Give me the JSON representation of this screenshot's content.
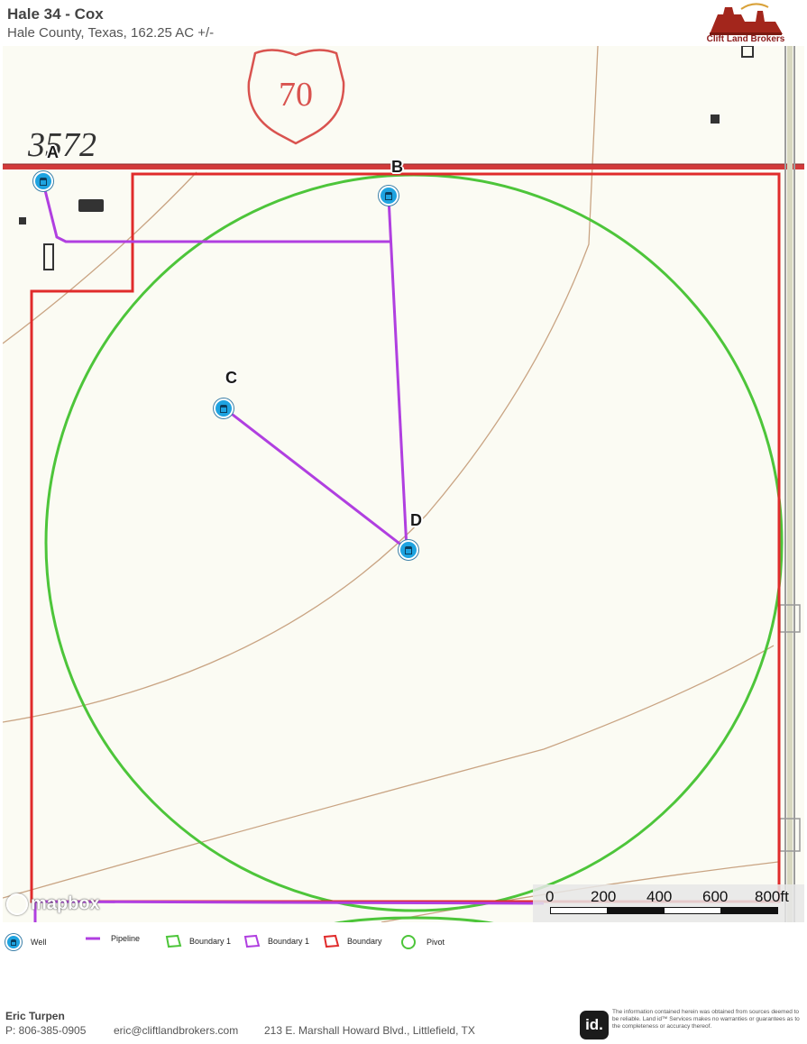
{
  "header": {
    "title": "Hale 34 - Cox",
    "subtitle": "Hale County, Texas, 162.25 AC +/-",
    "logo_text": "Clift Land Brokers"
  },
  "map": {
    "basemap_labels": {
      "route": "70",
      "road": "3572"
    },
    "wells": [
      {
        "label": "A"
      },
      {
        "label": "B"
      },
      {
        "label": "C"
      },
      {
        "label": "D"
      }
    ],
    "attribution": "mapbox",
    "scale": {
      "labels": [
        "0",
        "200",
        "400",
        "600",
        "800ft"
      ]
    }
  },
  "legend": {
    "items": [
      {
        "label": "Well",
        "icon": "well-icon",
        "color": "#1ea3e0"
      },
      {
        "label": "Pipeline",
        "icon": "pipeline-line-icon",
        "color": "#b03fe0"
      },
      {
        "label": "Boundary 1",
        "icon": "boundary-polygon-icon",
        "color": "#4dc53a"
      },
      {
        "label": "Boundary 1",
        "icon": "boundary-polygon-icon",
        "color": "#b03fe0"
      },
      {
        "label": "Boundary",
        "icon": "boundary-polygon-icon",
        "color": "#e02b2b"
      },
      {
        "label": "Pivot",
        "icon": "pivot-circle-icon",
        "color": "#4dc53a"
      }
    ]
  },
  "footer": {
    "name": "Eric Turpen",
    "phone": "P: 806-385-0905",
    "email": "eric@cliftlandbrokers.com",
    "address": "213 E. Marshall Howard Blvd., Littlefield, TX",
    "id_logo": "id.",
    "disclaimer": "The information contained herein was obtained from sources deemed to be reliable. Land id™ Services makes no warranties or guarantees as to the completeness or accuracy thereof."
  }
}
